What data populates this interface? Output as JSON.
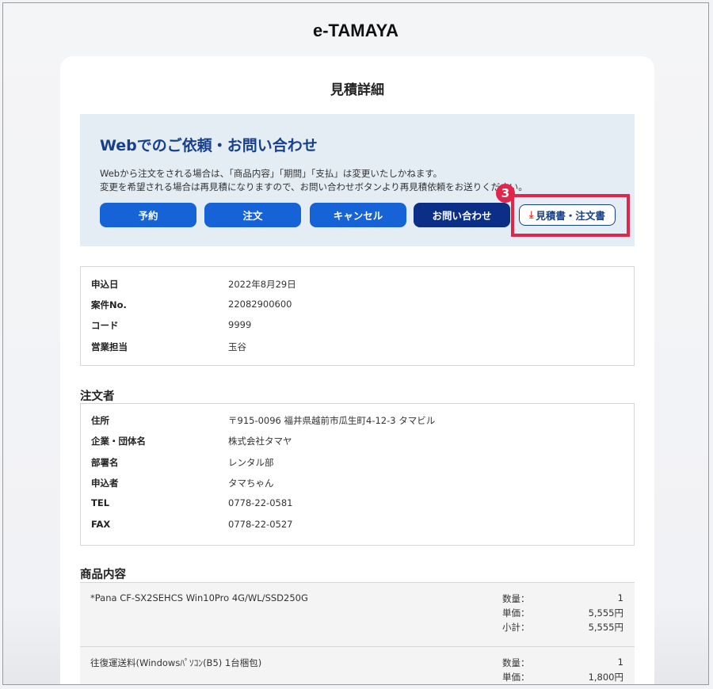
{
  "site": {
    "title": "e-TAMAYA"
  },
  "page": {
    "title": "見積詳細"
  },
  "web_section": {
    "title": "Webでのご依頼・お問い合わせ",
    "desc_line1": "Webから注文をされる場合は、「商品内容」「期間」「支払」は変更いたしかねます。",
    "desc_line2": "変更を希望される場合は再見積になりますので、お問い合わせボタンより再見積依頼をお送りください。",
    "buttons": {
      "reserve": "予約",
      "order": "注文",
      "cancel": "キャンセル",
      "inquiry": "お問い合わせ",
      "pdf": "見積書・注文書"
    },
    "step_badge": "3",
    "highlight_color": "#e2254a"
  },
  "quote_info": [
    {
      "label": "申込日",
      "value": "2022年8月29日"
    },
    {
      "label": "案件No.",
      "value": "22082900600"
    },
    {
      "label": "コード",
      "value": "9999"
    },
    {
      "label": "営業担当",
      "value": "玉谷"
    }
  ],
  "orderer": {
    "heading": "注文者",
    "rows": [
      {
        "label": "住所",
        "value": "〒915-0096 福井県越前市瓜生町4-12-3 タマビル"
      },
      {
        "label": "企業・団体名",
        "value": "株式会社タマヤ"
      },
      {
        "label": "部署名",
        "value": "レンタル部"
      },
      {
        "label": "申込者",
        "value": "タマちゃん"
      },
      {
        "label": "TEL",
        "value": "0778-22-0581"
      },
      {
        "label": "FAX",
        "value": "0778-22-0527"
      }
    ]
  },
  "products": {
    "heading": "商品内容",
    "items": [
      {
        "name": "*Pana CF-SX2SEHCS Win10Pro 4G/WL/SSD250G",
        "qty_label": "数量：",
        "qty": "1",
        "price_label": "単価：",
        "price": "5,555円",
        "subtotal_label": "小計：",
        "subtotal": "5,555円"
      },
      {
        "name": "往復運送料(Windowsﾊﾟｿｺﾝ(B5) 1台梱包)",
        "qty_label": "数量：",
        "qty": "1",
        "price_label": "単価：",
        "price": "1,800円"
      }
    ]
  },
  "colors": {
    "primary": "#1663d7",
    "dark": "#0b2f86",
    "heading_blue": "#17408c",
    "panel_bg": "#e5edf4"
  }
}
